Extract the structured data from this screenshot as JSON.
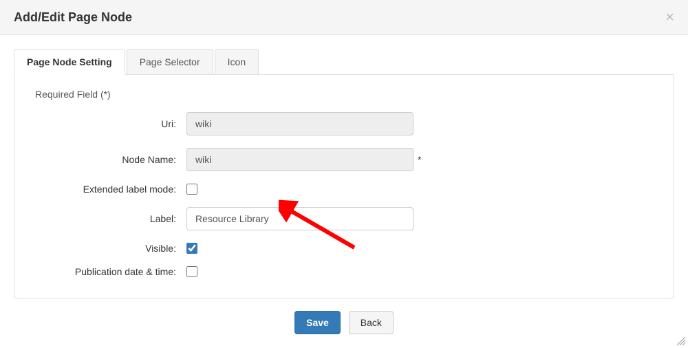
{
  "header": {
    "title": "Add/Edit Page Node"
  },
  "tabs": [
    {
      "label": "Page Node Setting",
      "active": true
    },
    {
      "label": "Page Selector",
      "active": false
    },
    {
      "label": "Icon",
      "active": false
    }
  ],
  "form": {
    "required_note": "Required Field (*)",
    "uri_label": "Uri:",
    "uri_value": "wiki",
    "node_name_label": "Node Name:",
    "node_name_value": "wiki",
    "node_name_required_mark": "*",
    "extended_label_mode_label": "Extended label mode:",
    "extended_label_mode_checked": false,
    "label_label": "Label:",
    "label_value": "Resource Library",
    "visible_label": "Visible:",
    "visible_checked": true,
    "pubdate_label": "Publication date & time:",
    "pubdate_checked": false
  },
  "buttons": {
    "save": "Save",
    "back": "Back"
  }
}
